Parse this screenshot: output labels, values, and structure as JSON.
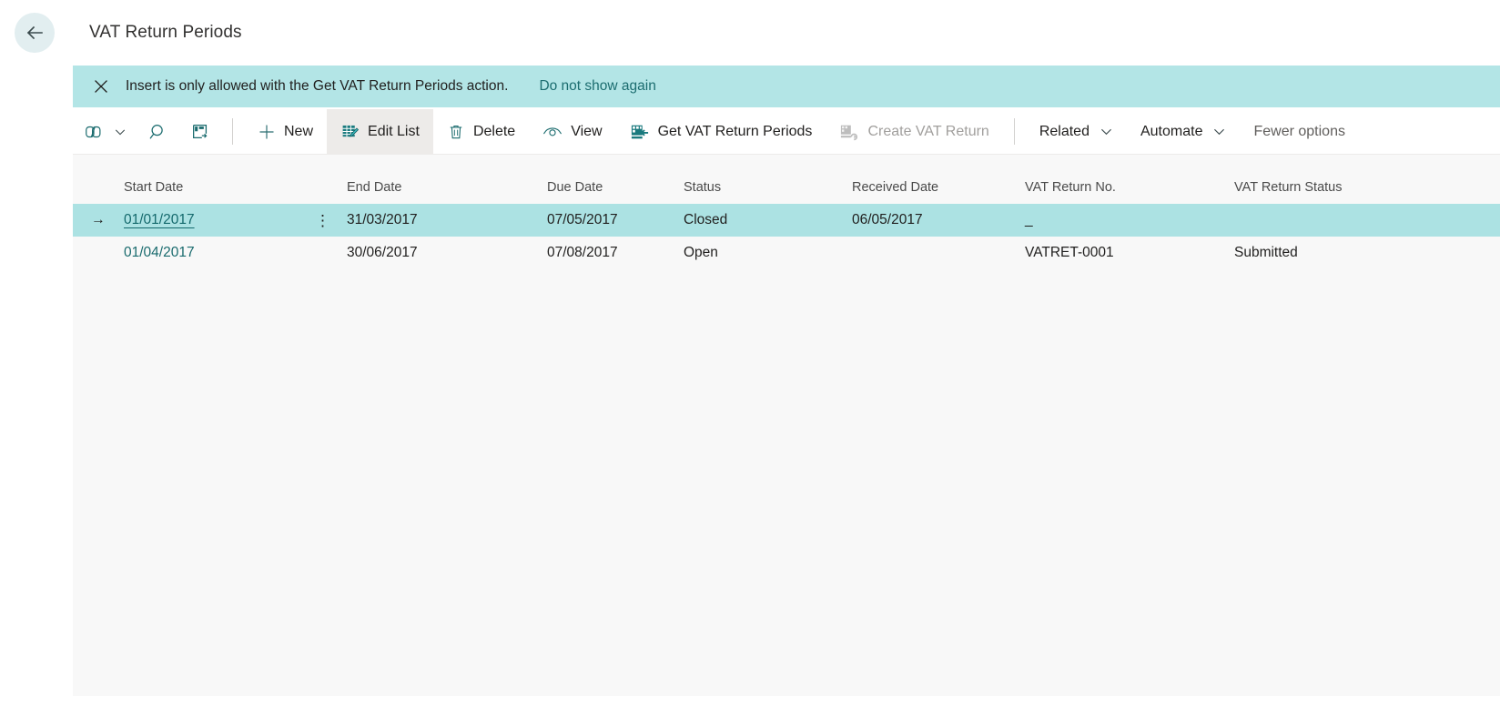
{
  "header": {
    "back_label": "Back",
    "title": "VAT Return Periods"
  },
  "notification": {
    "close_label": "Close",
    "message": "Insert is only allowed with the Get VAT Return Periods action.",
    "dismiss_link": "Do not show again",
    "background": "#b3e5e6"
  },
  "toolbar": {
    "share_label": "Share",
    "search_label": "Search",
    "open_new_window_label": "Open in new window",
    "new_label": "New",
    "edit_list_label": "Edit List",
    "delete_label": "Delete",
    "view_label": "View",
    "get_vat_return_periods_label": "Get VAT Return Periods",
    "create_vat_return_label": "Create VAT Return",
    "related_label": "Related",
    "automate_label": "Automate",
    "fewer_options_label": "Fewer options"
  },
  "grid": {
    "columns": [
      {
        "key": "start",
        "label": "Start Date"
      },
      {
        "key": "end",
        "label": "End Date"
      },
      {
        "key": "due",
        "label": "Due Date"
      },
      {
        "key": "status",
        "label": "Status"
      },
      {
        "key": "recv",
        "label": "Received Date"
      },
      {
        "key": "vatno",
        "label": "VAT Return No."
      },
      {
        "key": "vatst",
        "label": "VAT Return Status"
      }
    ],
    "rows": [
      {
        "selected": true,
        "row_indicator": "→",
        "start": "01/01/2017",
        "row_menu": "⋮",
        "end": "31/03/2017",
        "due": "07/05/2017",
        "status": "Closed",
        "recv": "06/05/2017",
        "vatno": "_",
        "vatst": ""
      },
      {
        "selected": false,
        "row_indicator": "",
        "start": "01/04/2017",
        "row_menu": "",
        "end": "30/06/2017",
        "due": "07/08/2017",
        "status": "Open",
        "recv": "",
        "vatno": "VATRET-0001",
        "vatst": "Submitted"
      }
    ]
  },
  "colors": {
    "accent_teal": "#1a6b6e",
    "selection": "#ace2e3",
    "grid_background": "#f8f8f8"
  }
}
